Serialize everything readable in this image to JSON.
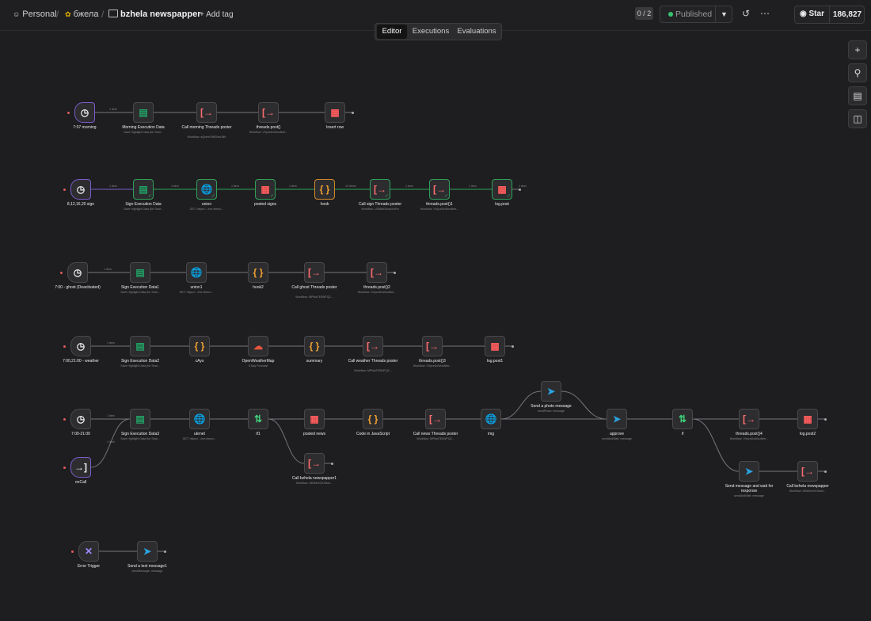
{
  "header": {
    "personal": "Personal",
    "folder": "бжела",
    "workflow_name": "bzhela newspapper",
    "add_tag": "+ Add tag",
    "counter": "0 / 2",
    "published": "Published",
    "github_star": "Star",
    "github_count": "186,827"
  },
  "tabs": [
    "Editor",
    "Executions",
    "Evaluations"
  ],
  "sidebar_icons": [
    "plus-icon",
    "search-icon",
    "sticky-note-icon",
    "panel-icon"
  ],
  "colors": {
    "accent_green": "#37c36f",
    "canvas_bg": "#1e1e20",
    "node_bg": "#2d2d30"
  },
  "nodes": [
    {
      "id": "n1",
      "icon": "clock",
      "kind": "trigger",
      "status": "pur",
      "label": "7:07 morning",
      "sub": ""
    },
    {
      "id": "n2",
      "icon": "sheet",
      "kind": "action",
      "status": "",
      "label": "Morning Execution Data",
      "sub": "Save Highlight Data (for Sear..."
    },
    {
      "id": "n3",
      "icon": "exec",
      "kind": "action",
      "status": "",
      "label": "Call morning Threads poster",
      "sub": "Workflow: aQsemOWEhiwJNh"
    },
    {
      "id": "n4",
      "icon": "exec",
      "kind": "action",
      "status": "",
      "label": "threads.post()",
      "sub": "Workflow: VVyzeDoWouNeb..."
    },
    {
      "id": "n5",
      "icon": "table",
      "kind": "action",
      "status": "",
      "label": "Insert row",
      "sub": ""
    },
    {
      "id": "s1",
      "icon": "clock",
      "kind": "trigger",
      "status": "pur",
      "label": "8,12,16,20 sign",
      "sub": ""
    },
    {
      "id": "s2",
      "icon": "sheet",
      "kind": "action",
      "status": "ok",
      "label": "Sign Execution Data",
      "sub": "Save Highlight Data (for Sear..."
    },
    {
      "id": "s3",
      "icon": "globe",
      "kind": "action",
      "status": "ok",
      "label": "union",
      "sub": "GET: https://.../me.ekeru/..."
    },
    {
      "id": "s4",
      "icon": "table",
      "kind": "action",
      "status": "ok",
      "label": "posted signs",
      "sub": ""
    },
    {
      "id": "s5",
      "icon": "code",
      "kind": "action",
      "status": "orange",
      "label": "hook",
      "sub": ""
    },
    {
      "id": "s6",
      "icon": "exec",
      "kind": "action",
      "status": "ok",
      "label": "Call sign Threads poster",
      "sub": "Workflow: U3M4sEAvzpVuFw"
    },
    {
      "id": "s7",
      "icon": "exec",
      "kind": "action",
      "status": "ok",
      "label": "threads.post()1",
      "sub": "Workflow: VVyzeDoWouNeb..."
    },
    {
      "id": "s8",
      "icon": "table",
      "kind": "action",
      "status": "ok",
      "label": "log.post",
      "sub": ""
    },
    {
      "id": "g1",
      "icon": "clock",
      "kind": "trigger",
      "status": "",
      "label": "7:00 - ghost (Deactivated)",
      "sub": ""
    },
    {
      "id": "g2",
      "icon": "sheet",
      "kind": "action",
      "status": "",
      "label": "Sign Execution Data1",
      "sub": "Save Highlight Data (for Sear..."
    },
    {
      "id": "g3",
      "icon": "globe",
      "kind": "action",
      "status": "",
      "label": "union1",
      "sub": "GET: https://.../me.ekeru/..."
    },
    {
      "id": "g4",
      "icon": "code",
      "kind": "action",
      "status": "",
      "label": "hook2",
      "sub": ""
    },
    {
      "id": "g5",
      "icon": "exec",
      "kind": "action",
      "status": "",
      "label": "Call ghost Threads poster",
      "sub": "Workflow: MPNwTE0WFQZ..."
    },
    {
      "id": "g6",
      "icon": "exec",
      "kind": "action",
      "status": "",
      "label": "threads.post()2",
      "sub": "Workflow: VVyzeDoWouNeb..."
    },
    {
      "id": "w1",
      "icon": "clock",
      "kind": "trigger",
      "status": "",
      "label": "7:00,21:00 - weather",
      "sub": ""
    },
    {
      "id": "w2",
      "icon": "sheet",
      "kind": "action",
      "status": "",
      "label": "Sign Execution Data2",
      "sub": "Save Highlight Data (for Sear..."
    },
    {
      "id": "w3",
      "icon": "code",
      "kind": "action",
      "status": "",
      "label": "cAys",
      "sub": ""
    },
    {
      "id": "w4",
      "icon": "weather",
      "kind": "action",
      "status": "",
      "label": "OpenWeatherMap",
      "sub": "5 Day Forecast"
    },
    {
      "id": "w5",
      "icon": "code",
      "kind": "action",
      "status": "",
      "label": "summary",
      "sub": ""
    },
    {
      "id": "w6",
      "icon": "exec",
      "kind": "action",
      "status": "",
      "label": "Call weather Threads poster",
      "sub": "Workflow: MPNwTE0WFQZ..."
    },
    {
      "id": "w7",
      "icon": "exec",
      "kind": "action",
      "status": "",
      "label": "threads.post()3",
      "sub": "Workflow: VVyzeDoWouNeb..."
    },
    {
      "id": "w8",
      "icon": "table",
      "kind": "action",
      "status": "",
      "label": "log.post1",
      "sub": ""
    },
    {
      "id": "b1",
      "icon": "clock",
      "kind": "trigger",
      "status": "",
      "label": "7:00-21:00",
      "sub": ""
    },
    {
      "id": "b0",
      "icon": "call",
      "kind": "trigger",
      "status": "pur",
      "label": "onCall",
      "sub": ""
    },
    {
      "id": "b2",
      "icon": "sheet",
      "kind": "action",
      "status": "",
      "label": "Sign Execution Data3",
      "sub": "Save Highlight Data (for Sear..."
    },
    {
      "id": "b3",
      "icon": "globe",
      "kind": "action",
      "status": "",
      "label": "ukrnet",
      "sub": "GET: https://.../me.ekeru/..."
    },
    {
      "id": "b4",
      "icon": "if",
      "kind": "action",
      "status": "",
      "label": "if1",
      "sub": ""
    },
    {
      "id": "b5",
      "icon": "table",
      "kind": "action",
      "status": "",
      "label": "posted news",
      "sub": ""
    },
    {
      "id": "b6",
      "icon": "code",
      "kind": "action",
      "status": "",
      "label": "Code in JavaScript",
      "sub": ""
    },
    {
      "id": "b7",
      "icon": "exec",
      "kind": "action",
      "status": "",
      "label": "Call news Threads poster",
      "sub": "Workflow: MPNwTE0WFQZ..."
    },
    {
      "id": "b8",
      "icon": "globe",
      "kind": "action",
      "status": "",
      "label": "img",
      "sub": ""
    },
    {
      "id": "b9",
      "icon": "telegram",
      "kind": "action",
      "status": "",
      "label": "Send a photo message",
      "sub": "sendPhoto: message"
    },
    {
      "id": "b10",
      "icon": "telegram",
      "kind": "action",
      "status": "",
      "label": "approve",
      "sub": "sendAndWait: message"
    },
    {
      "id": "b11",
      "icon": "if",
      "kind": "action",
      "status": "",
      "label": "if",
      "sub": ""
    },
    {
      "id": "b12",
      "icon": "exec",
      "kind": "action",
      "status": "",
      "label": "threads.post()4",
      "sub": "Workflow: VVyzeDoWouNeb..."
    },
    {
      "id": "b13",
      "icon": "table",
      "kind": "action",
      "status": "",
      "label": "log.post2",
      "sub": ""
    },
    {
      "id": "b14",
      "icon": "exec",
      "kind": "action",
      "status": "",
      "label": "Call bzhela newspapper1",
      "sub": "Workflow: rBWdmrOKSdub..."
    },
    {
      "id": "b15",
      "icon": "telegram",
      "kind": "action",
      "status": "",
      "label": "Send message and wait for response",
      "sub": "sendAndWait: message"
    },
    {
      "id": "b16",
      "icon": "exec",
      "kind": "action",
      "status": "",
      "label": "Call bzhela newspapper",
      "sub": "Workflow: rBWdmrOKSdub..."
    },
    {
      "id": "e1",
      "icon": "error",
      "kind": "trigger",
      "status": "",
      "label": "Error Trigger",
      "sub": ""
    },
    {
      "id": "e2",
      "icon": "telegram",
      "kind": "action",
      "status": "",
      "label": "Send a text message1",
      "sub": "sendMessage: message"
    }
  ],
  "edge_labels": [
    "1 item",
    "1 item",
    "1 item",
    "1 item",
    "1 item",
    "12 items",
    "1 item",
    "1 item",
    "1 item",
    "1 item",
    "1 item",
    "1 item",
    "1 item"
  ]
}
